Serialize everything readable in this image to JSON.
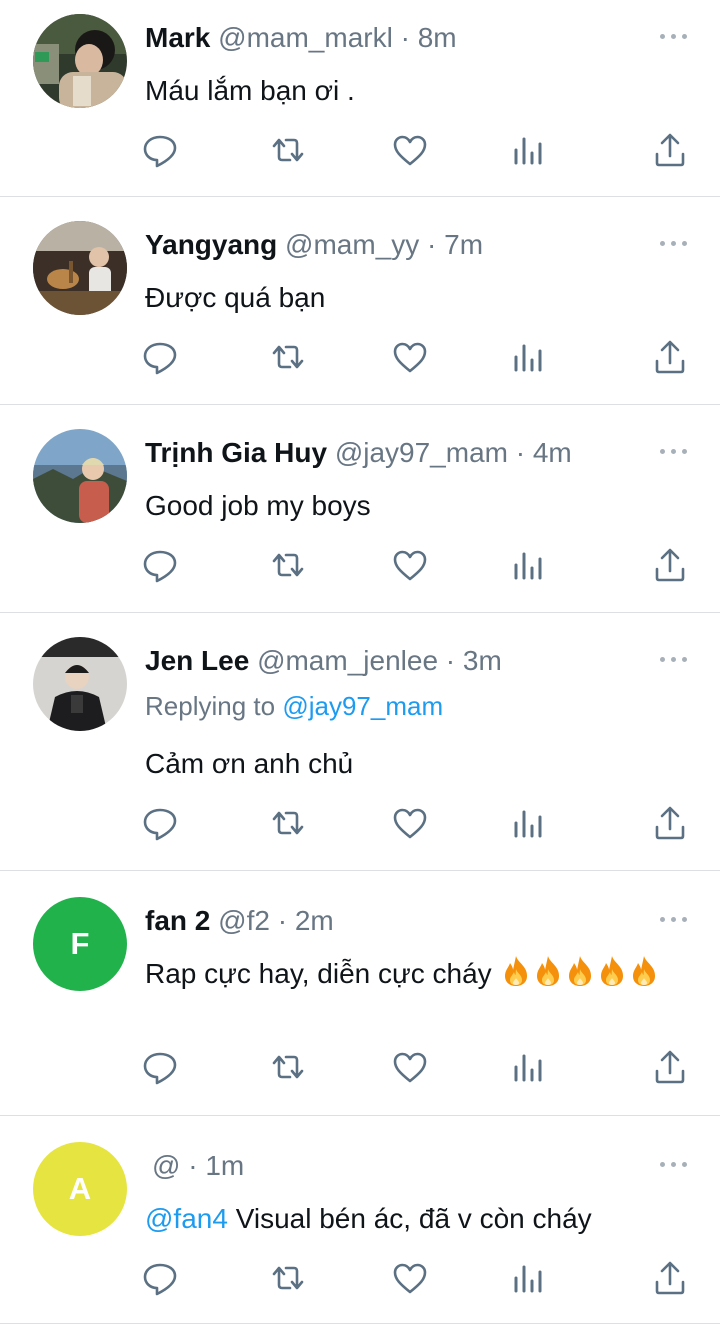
{
  "colors": {
    "text": "#0f1419",
    "secondary": "#687684",
    "link": "#1d9bf0",
    "divider": "#dcdfe3",
    "icon": "#5b7083",
    "fire": "#f4900c"
  },
  "tweets": [
    {
      "name": "Mark",
      "handle": "@mam_markl",
      "dot": "·",
      "time": "8m",
      "text": "Máu lắm bạn ơi .",
      "avatar": "photo-avatar-icon"
    },
    {
      "name": "Yangyang",
      "handle": "@mam_yy",
      "dot": "·",
      "time": "7m",
      "text": "Được quá bạn",
      "avatar": "photo-avatar-icon"
    },
    {
      "name": "Trịnh Gia Huy",
      "handle": "@jay97_mam",
      "dot": "·",
      "time": "4m",
      "text": "Good job my boys",
      "avatar": "photo-avatar-icon"
    },
    {
      "name": "Jen Lee",
      "handle": "@mam_jenlee",
      "dot": "·",
      "time": "3m",
      "replying_label": "Replying to",
      "replying_handle": "@jay97_mam",
      "text": "Cảm ơn anh chủ",
      "avatar": "photo-avatar-icon"
    },
    {
      "name": "fan 2",
      "handle": "@f2",
      "dot": "·",
      "time": "2m",
      "text": "Rap cực hay, diễn cực cháy",
      "emoji": "fire-emoji-icon",
      "avatar_letter": "F",
      "avatar_color": "#22b24c"
    },
    {
      "handle": "@",
      "dot": "·",
      "time": "1m",
      "mention": "@fan4",
      "text": "Visual bén ác, đã v còn cháy",
      "avatar_letter": "A",
      "avatar_color": "#e6e441"
    }
  ],
  "action_icons": [
    "reply-icon",
    "retweet-icon",
    "like-icon",
    "views-icon",
    "share-icon"
  ]
}
